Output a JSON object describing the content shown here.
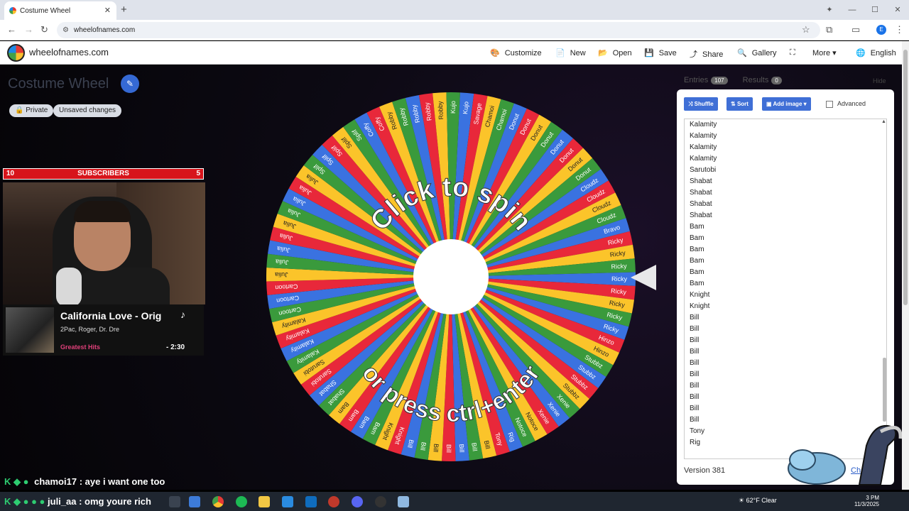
{
  "browser": {
    "tab_title": "Costume Wheel",
    "tab_close": "✕",
    "new_tab": "+",
    "url": "wheelofnames.com",
    "profile_initial": "E",
    "window_controls": [
      "—",
      "☐",
      "✕"
    ]
  },
  "header": {
    "site_name": "wheelofnames.com",
    "menu": [
      {
        "icon": "palette-icon",
        "glyph": "🎨",
        "label": "Customize"
      },
      {
        "icon": "file-icon",
        "glyph": "📄",
        "label": "New"
      },
      {
        "icon": "folder-icon",
        "glyph": "📂",
        "label": "Open"
      },
      {
        "icon": "save-icon",
        "glyph": "💾",
        "label": "Save"
      },
      {
        "icon": "share-icon",
        "glyph": "⤴",
        "label": "Share"
      },
      {
        "icon": "search-icon",
        "glyph": "🔍",
        "label": "Gallery"
      },
      {
        "icon": "fullscreen-icon",
        "glyph": "⛶",
        "label": ""
      },
      {
        "icon": "chevron-down-icon",
        "glyph": "▾",
        "label": "More"
      },
      {
        "icon": "globe-icon",
        "glyph": "🌐",
        "label": "English"
      }
    ]
  },
  "wheel": {
    "title": "Costume Wheel",
    "private_label": "Private",
    "unsaved_label": "Unsaved changes",
    "top_text": "Click to spin",
    "bottom_text": "or press ctrl+enter",
    "segment_labels": [
      "Robby",
      "Robby",
      "Kujo",
      "Kujo",
      "Savage",
      "Chamoi",
      "Chamoi",
      "Donut",
      "Donut",
      "Donut",
      "Donut",
      "Donut",
      "Donut",
      "Donut",
      "Donut",
      "Cloudz",
      "Cloudz",
      "Cloudz",
      "Cloudz",
      "Bravo",
      "Ricky",
      "Ricky",
      "Ricky",
      "Ricky",
      "Ricky",
      "Ricky",
      "Ricky",
      "Ricky",
      "Hinzo",
      "Hinzo",
      "Stubbz",
      "Stubbz",
      "Stubbz",
      "Stubbz",
      "Xenie",
      "Xenie",
      "Xenie",
      "Notoce",
      "Notoce",
      "Rig",
      "Tony",
      "Bill",
      "Bill",
      "Bill",
      "Bill",
      "Bill",
      "Bill",
      "Bill",
      "Knight",
      "Knight",
      "Bam",
      "Bam",
      "Bam",
      "Bam",
      "Shabat",
      "Shabat",
      "Sarutobi",
      "Sarutobi",
      "Kalamity",
      "Kalamity",
      "Kalamity",
      "Kalamity",
      "Cartoon",
      "Cartoon",
      "Cartoon",
      "Julia",
      "Julia",
      "Julia",
      "Julia",
      "Julia",
      "Julia",
      "Julia",
      "Julia",
      "Julia",
      "Splif",
      "Splif",
      "Splif",
      "Splif",
      "Splif",
      "Coffy",
      "Coffy",
      "Robby",
      "Robby",
      "Robby"
    ],
    "colors": [
      "#e8283a",
      "#fbc42a",
      "#3a9a3c",
      "#3a72e0"
    ]
  },
  "stream": {
    "subs_left": "10",
    "subs_label": "SUBSCRIBERS",
    "subs_right": "5",
    "song_title": "California Love - Orig",
    "song_artist": "2Pac, Roger, Dr. Dre",
    "song_album": "Greatest Hits",
    "song_time": "- 2:30",
    "chat_line1_user": "chamoi17",
    "chat_line1_text": ": aye i want one too",
    "chat_line2_user": "juli_aa",
    "chat_line2_text": ": omg youre rich"
  },
  "panel": {
    "tab_entries": "Entries",
    "entries_count": "107",
    "tab_results": "Results",
    "results_count": "0",
    "hide_label": "Hide",
    "shuffle_label": "Shuffle",
    "sort_label": "Sort",
    "add_image_label": "Add image",
    "advanced_label": "Advanced",
    "entries": [
      "Kalamity",
      "Kalamity",
      "Kalamity",
      "Kalamity",
      "Sarutobi",
      "Shabat",
      "Shabat",
      "Shabat",
      "Shabat",
      "Bam",
      "Bam",
      "Bam",
      "Bam",
      "Bam",
      "Bam",
      "Knight",
      "Knight",
      "Bill",
      "Bill",
      "Bill",
      "Bill",
      "Bill",
      "Bill",
      "Bill",
      "Bill",
      "Bill",
      "Bill",
      "Tony",
      "Rig"
    ],
    "version": "Version 381",
    "changelog": "Cha"
  },
  "taskbar": {
    "weather": "62°F",
    "weather_desc": "Clear",
    "time": "3 PM",
    "date": "11/3/2025"
  }
}
